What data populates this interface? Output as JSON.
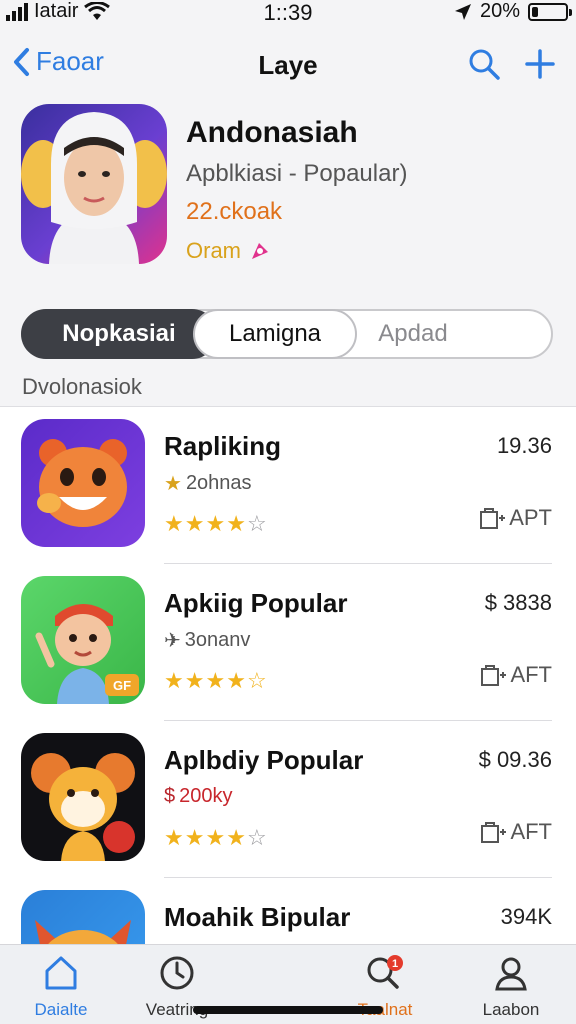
{
  "status_bar": {
    "carrier": "Iatair",
    "time": "1::39",
    "battery": "20%",
    "battery_level": 0.2
  },
  "nav": {
    "back_label": "Faoar",
    "title": "Laye"
  },
  "header": {
    "app_name": "Andonasiah",
    "subtitle": "Apblkiasi - Popaular)",
    "count": "22.ckoak",
    "tag": "Oram"
  },
  "segments": [
    "Nopkasiai",
    "Lamigna",
    "Apdad"
  ],
  "section_label": "Dvolonasiok",
  "apps": [
    {
      "name": "Rapliking",
      "sub": "2ohnas",
      "sub_icon": "star-icon",
      "rating": 4,
      "price": "19.36",
      "action": "APT"
    },
    {
      "name": "Apkiig Popular",
      "sub": "3onanv",
      "sub_icon": "airplane-icon",
      "rating": 4.5,
      "price": "$ 3838",
      "action": "AFT"
    },
    {
      "name": "Aplbdiy Popular",
      "sub": "200ky",
      "sub_icon": "dollar-icon",
      "rating": 4,
      "price": "$ 09.36",
      "action": "AFT"
    },
    {
      "name": "Moahik Bipular",
      "sub": "",
      "sub_icon": "",
      "rating": 0,
      "price": "394K",
      "action": ""
    }
  ],
  "tabs": [
    {
      "label": "Daialte",
      "icon": "home-icon",
      "active": true
    },
    {
      "label": "Veatring",
      "icon": "clock-icon",
      "active": false
    },
    {
      "label": "Taalnat",
      "icon": "search-icon",
      "active": false,
      "badge": "1"
    },
    {
      "label": "Laabon",
      "icon": "person-icon",
      "active": false
    }
  ],
  "colors": {
    "accent": "#2f7de1",
    "star": "#f1b21c",
    "count": "#e0711b",
    "badge": "#e43b2c"
  }
}
